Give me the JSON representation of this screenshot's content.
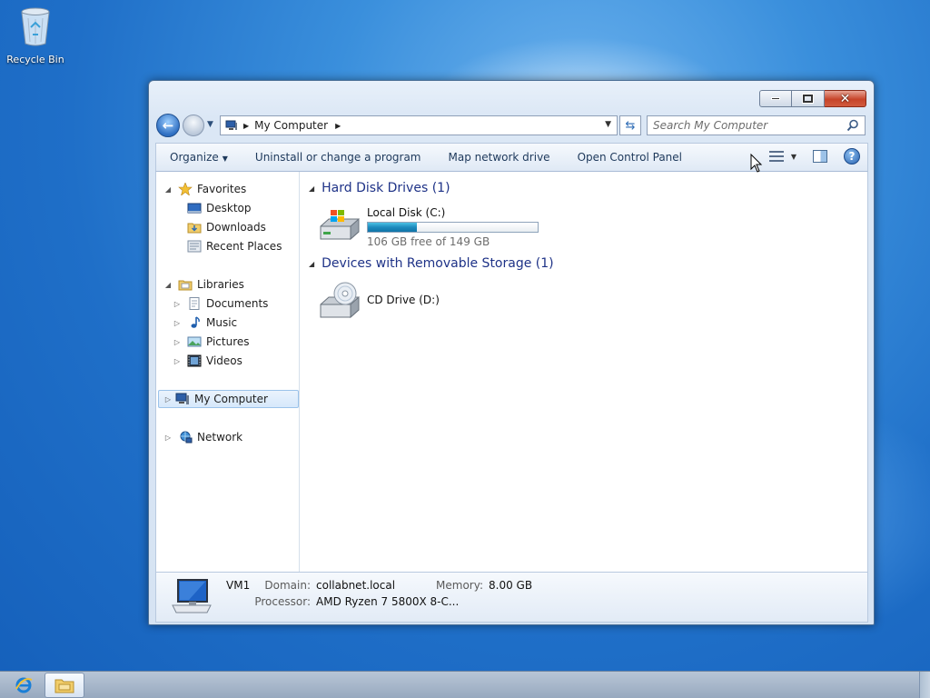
{
  "desktop": {
    "recycle_bin_label": "Recycle Bin"
  },
  "window": {
    "controls": {
      "minimize": "minimize",
      "maximize": "maximize",
      "close": "close"
    },
    "address": {
      "crumbs": [
        "My Computer"
      ]
    },
    "search": {
      "placeholder": "Search My Computer"
    },
    "commands": {
      "organize": "Organize",
      "uninstall": "Uninstall or change a program",
      "map_drive": "Map network drive",
      "control_panel": "Open Control Panel"
    },
    "nav": {
      "favorites": {
        "label": "Favorites",
        "items": [
          "Desktop",
          "Downloads",
          "Recent Places"
        ]
      },
      "libraries": {
        "label": "Libraries",
        "items": [
          "Documents",
          "Music",
          "Pictures",
          "Videos"
        ]
      },
      "computer": "My Computer",
      "network": "Network"
    },
    "groups": [
      {
        "title": "Hard Disk Drives (1)",
        "drives": [
          {
            "name": "Local Disk (C:)",
            "free_text": "106 GB free of 149 GB",
            "used_fraction": 0.289
          }
        ]
      },
      {
        "title": "Devices with Removable Storage (1)",
        "drives": [
          {
            "name": "CD Drive (D:)"
          }
        ]
      }
    ],
    "details": {
      "machine_name": "VM1",
      "domain_label": "Domain:",
      "domain_value": "collabnet.local",
      "memory_label": "Memory:",
      "memory_value": "8.00 GB",
      "processor_label": "Processor:",
      "processor_value": "AMD Ryzen 7 5800X 8-C..."
    }
  },
  "taskbar": {
    "buttons": [
      "internet-explorer-icon",
      "windows-explorer-icon"
    ]
  },
  "colors": {
    "desktop_blue": "#1f6fc8",
    "link_blue": "#1e3287",
    "capacity_fill": "#1e8bbd",
    "close_red": "#c74429"
  }
}
